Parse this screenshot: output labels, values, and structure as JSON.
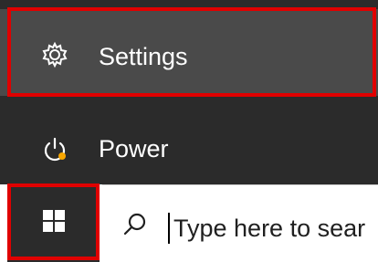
{
  "start_menu": {
    "items": [
      {
        "label": "Settings",
        "icon": "gear-icon"
      },
      {
        "label": "Power",
        "icon": "power-icon"
      }
    ]
  },
  "taskbar": {
    "start_icon": "windows-logo-icon",
    "search": {
      "icon": "search-icon",
      "placeholder": "Type here to sear"
    }
  },
  "colors": {
    "menu_background": "#2b2b2b",
    "settings_highlight_background": "#4a4a4a",
    "annotation_border": "#e00000",
    "power_badge": "#f7a600",
    "taskbar_search_background": "#ffffff"
  }
}
